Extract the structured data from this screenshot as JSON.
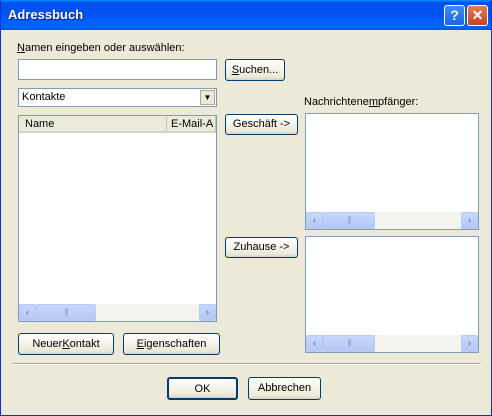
{
  "window": {
    "title": "Adressbuch",
    "help_label": "?",
    "close_label": "✕"
  },
  "search": {
    "label_prefix": "N",
    "label_rest": "amen eingeben oder auswählen:",
    "value": "",
    "button_u": "S",
    "button_rest": "uchen..."
  },
  "source": {
    "selected": "Kontakte"
  },
  "contacts": {
    "columns": [
      "Name",
      "E-Mail-A"
    ],
    "rows": []
  },
  "actions": {
    "business_button": "Geschäft ->",
    "home_button": "Zuhause ->"
  },
  "recipients": {
    "label_pre": "Nachrichtene",
    "label_u": "m",
    "label_post": "pfänger:"
  },
  "bottom_buttons": {
    "new_contact_pre": "Neuer ",
    "new_contact_u": "K",
    "new_contact_post": "ontakt",
    "properties_u": "E",
    "properties_post": "igenschaften"
  },
  "dialog": {
    "ok": "OK",
    "cancel": "Abbrechen"
  },
  "icons": {
    "scroll_left": "‹",
    "scroll_right": "›",
    "thumb": "|||",
    "dropdown": "▼"
  }
}
